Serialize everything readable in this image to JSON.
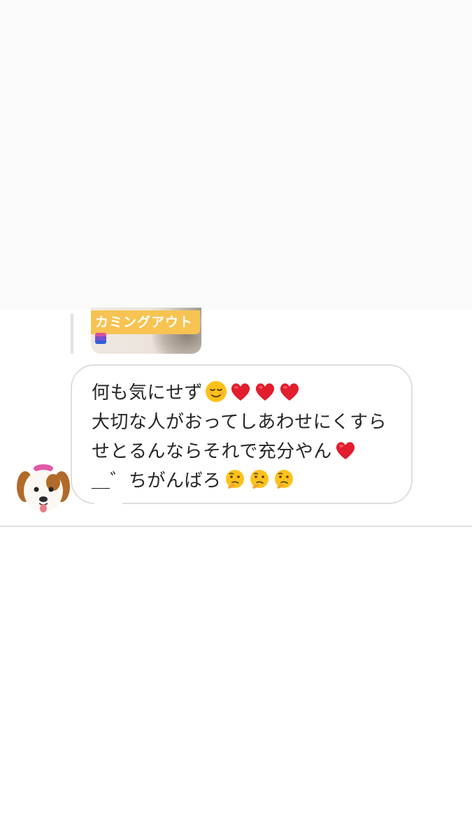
{
  "reply_preview": {
    "label": "カミングアウト",
    "flag_colors": [
      "#d94fa0",
      "#7b4fc9",
      "#2f62d8"
    ]
  },
  "message": {
    "lines": [
      {
        "text": "何も気にせず",
        "emojis": [
          "relieved-face-emoji",
          "red-heart-emoji",
          "red-heart-emoji",
          "red-heart-emoji"
        ]
      },
      {
        "text": "大切な人がおってしあわせにくすら",
        "emojis": []
      },
      {
        "text": "せとるんならそれで充分やん",
        "emojis": [
          "red-heart-emoji"
        ]
      },
      {
        "text": "＿゛ちがんばろ",
        "emojis": [
          "thinking-face-emoji",
          "thinking-face-emoji",
          "thinking-face-emoji"
        ]
      }
    ]
  },
  "sender": {
    "avatar": "dog-memoji-icon"
  },
  "colors": {
    "reply_label_bg": "#f7c352",
    "bubble_border": "#dedede",
    "text": "#262626",
    "heart": "#e11d2e"
  }
}
